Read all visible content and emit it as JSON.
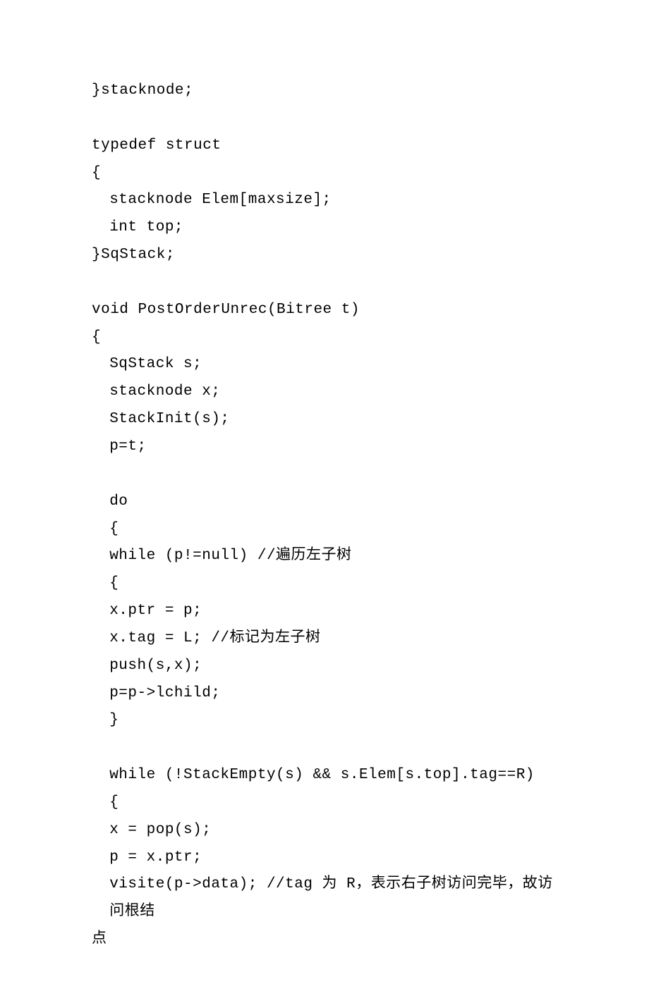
{
  "lines": [
    {
      "indent": 0,
      "text": "}stacknode;"
    },
    {
      "indent": 0,
      "text": ""
    },
    {
      "indent": 0,
      "text": "typedef struct"
    },
    {
      "indent": 0,
      "text": "{"
    },
    {
      "indent": 1,
      "text": "stacknode Elem[maxsize];"
    },
    {
      "indent": 1,
      "text": "int top;"
    },
    {
      "indent": 0,
      "text": "}SqStack;"
    },
    {
      "indent": 0,
      "text": ""
    },
    {
      "indent": 0,
      "text": "void PostOrderUnrec(Bitree t)"
    },
    {
      "indent": 0,
      "text": "{"
    },
    {
      "indent": 1,
      "text": "SqStack s;"
    },
    {
      "indent": 1,
      "text": "stacknode x;"
    },
    {
      "indent": 1,
      "text": "StackInit(s);"
    },
    {
      "indent": 1,
      "text": "p=t;"
    },
    {
      "indent": 0,
      "text": ""
    },
    {
      "indent": 1,
      "text": "do"
    },
    {
      "indent": 1,
      "text": "{"
    },
    {
      "indent": 1,
      "text": "while (p!=null) //遍历左子树"
    },
    {
      "indent": 1,
      "text": "{"
    },
    {
      "indent": 1,
      "text": "x.ptr = p;"
    },
    {
      "indent": 1,
      "text": "x.tag = L; //标记为左子树"
    },
    {
      "indent": 1,
      "text": "push(s,x);"
    },
    {
      "indent": 1,
      "text": "p=p->lchild;"
    },
    {
      "indent": 1,
      "text": "}"
    },
    {
      "indent": 0,
      "text": ""
    },
    {
      "indent": 1,
      "text": "while (!StackEmpty(s) && s.Elem[s.top].tag==R)"
    },
    {
      "indent": 1,
      "text": "{"
    },
    {
      "indent": 1,
      "text": "x = pop(s);"
    },
    {
      "indent": 1,
      "text": "p = x.ptr;"
    },
    {
      "indent": 1,
      "text": "visite(p->data); //tag 为 R，表示右子树访问完毕，故访问根结"
    },
    {
      "indent": 0,
      "text": "点"
    }
  ]
}
